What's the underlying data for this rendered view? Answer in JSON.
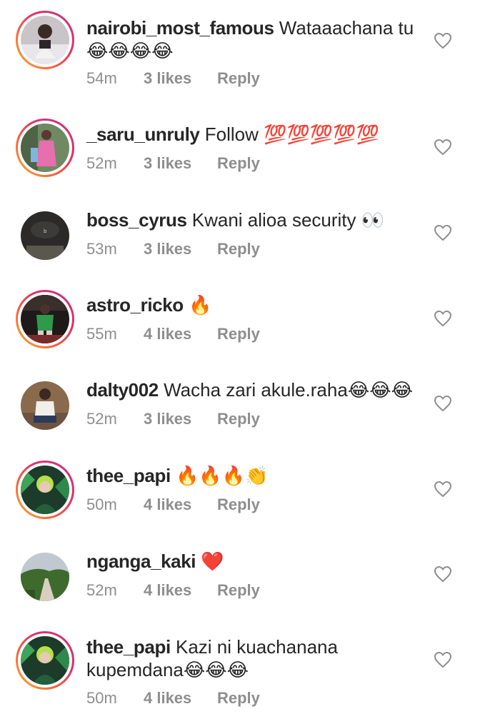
{
  "comments": [
    {
      "username": "nairobi_most_famous",
      "text": " Wataaachana tu 😂😂😂😂",
      "time": "54m",
      "likes": "3 likes",
      "reply": "Reply",
      "has_story_ring": true,
      "avatar": "woman-selfie-avatar"
    },
    {
      "username": "_saru_unruly",
      "text": " Follow 💯💯💯💯💯",
      "time": "52m",
      "likes": "3 likes",
      "reply": "Reply",
      "has_story_ring": true,
      "avatar": "pink-outfit-avatar"
    },
    {
      "username": "boss_cyrus",
      "text": " Kwani alioa security 👀",
      "time": "53m",
      "likes": "3 likes",
      "reply": "Reply",
      "has_story_ring": false,
      "avatar": "dark-cap-avatar"
    },
    {
      "username": "astro_ricko",
      "text": " 🔥",
      "time": "55m",
      "likes": "4 likes",
      "reply": "Reply",
      "has_story_ring": true,
      "avatar": "man-green-shirt-avatar"
    },
    {
      "username": "dalty002",
      "text": " Wacha zari akule.raha😂😂😂",
      "time": "52m",
      "likes": "3 likes",
      "reply": "Reply",
      "has_story_ring": false,
      "avatar": "seated-man-avatar"
    },
    {
      "username": "thee_papi",
      "text": " 🔥🔥🔥👏",
      "time": "50m",
      "likes": "4 likes",
      "reply": "Reply",
      "has_story_ring": true,
      "avatar": "green-hair-avatar"
    },
    {
      "username": "nganga_kaki",
      "text": " ❤️",
      "time": "52m",
      "likes": "4 likes",
      "reply": "Reply",
      "has_story_ring": false,
      "avatar": "landscape-road-avatar"
    },
    {
      "username": "thee_papi",
      "text": " Kazi ni kuachanana kupemdana😂😂😂",
      "time": "50m",
      "likes": "4 likes",
      "reply": "Reply",
      "has_story_ring": true,
      "avatar": "green-hair-avatar"
    }
  ],
  "colors": {
    "text": "#262626",
    "meta": "#8e8e8e",
    "story_ring_start": "#f9b233",
    "story_ring_end": "#c13584"
  },
  "icons": {
    "like": "heart-outline-icon"
  }
}
